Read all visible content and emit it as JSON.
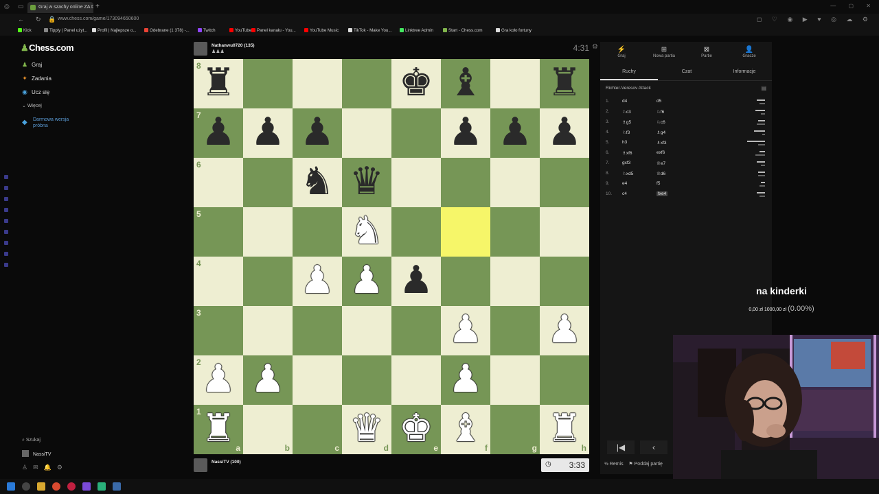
{
  "browser": {
    "tab_title": "Graj w szachy online ZA D...",
    "new_tab": "+",
    "url": "www.chess.com/game/173094650600"
  },
  "bookmarks": [
    {
      "label": "Kick",
      "color": "#53fc18"
    },
    {
      "label": "Tipply | Panel użyt...",
      "color": "#888888"
    },
    {
      "label": "Profil | Najlepsze o...",
      "color": "#dddddd"
    },
    {
      "label": "Odebrane (1 378) -...",
      "color": "#ea4335"
    },
    {
      "label": "Twitch",
      "color": "#9146ff"
    },
    {
      "label": "YouTube",
      "color": "#ff0000"
    },
    {
      "label": "Panel kanału - You...",
      "color": "#ff0000"
    },
    {
      "label": "YouTube Music",
      "color": "#ff0000"
    },
    {
      "label": "TikTok - Make You...",
      "color": "#dddddd"
    },
    {
      "label": "Linktree Admin",
      "color": "#43e660"
    },
    {
      "label": "Start - Chess.com",
      "color": "#81b64c"
    },
    {
      "label": "Gra koło fortuny",
      "color": "#dddddd"
    }
  ],
  "leftnav": {
    "logo": "Chess.com",
    "items": [
      {
        "label": "Graj",
        "icon": "board-icon",
        "glyph": "♟",
        "color": "#81b64c"
      },
      {
        "label": "Zadania",
        "icon": "puzzle-icon",
        "glyph": "✦",
        "color": "#e58f2a"
      },
      {
        "label": "Ucz się",
        "icon": "learn-icon",
        "glyph": "◉",
        "color": "#4aa3df"
      }
    ],
    "more": "Więcej",
    "trial": "Darmowa wersja próbna",
    "search": "Szukaj",
    "user": "NassiTV"
  },
  "players": {
    "top": {
      "name": "Nathanwu0720 (135)",
      "captured": "♟♟♟"
    },
    "bottom": {
      "name": "NassiTV (100)",
      "captured": ""
    }
  },
  "clocks": {
    "top": "4:31",
    "bottom": "3:33"
  },
  "board": {
    "ranks": [
      "8",
      "7",
      "6",
      "5",
      "4",
      "3",
      "2",
      "1"
    ],
    "files": [
      "a",
      "b",
      "c",
      "d",
      "e",
      "f",
      "g",
      "h"
    ],
    "highlight": [
      "f5"
    ],
    "pieces": {
      "a8": "bR",
      "e8": "bK",
      "f8": "bB",
      "h8": "bR",
      "a7": "bP",
      "b7": "bP",
      "c7": "bP",
      "f7": "bP",
      "g7": "bP",
      "h7": "bP",
      "c6": "bN",
      "d6": "bQ",
      "d5": "wN",
      "c4": "wP",
      "d4": "wP",
      "e4": "bP",
      "f3": "wP",
      "h3": "wP",
      "a2": "wP",
      "b2": "wP",
      "f2": "wP",
      "a1": "wR",
      "d1": "wQ",
      "e1": "wK",
      "f1": "wB",
      "h1": "wR"
    }
  },
  "panel": {
    "tabs": [
      {
        "label": "Graj",
        "glyph": "⚡"
      },
      {
        "label": "Nowa partia",
        "glyph": "⊞"
      },
      {
        "label": "Partie",
        "glyph": "⊠"
      },
      {
        "label": "Gracze",
        "glyph": "👤"
      }
    ],
    "subtabs": [
      "Ruchy",
      "Czat",
      "Informacje"
    ],
    "opening": "Richter-Veresov Attack",
    "moves": [
      {
        "n": "1.",
        "w": "d4",
        "b": "d5"
      },
      {
        "n": "2.",
        "w": "♘c3",
        "b": "♘f6"
      },
      {
        "n": "3.",
        "w": "♗g5",
        "b": "♘c6"
      },
      {
        "n": "4.",
        "w": "♘f3",
        "b": "♗g4"
      },
      {
        "n": "5.",
        "w": "h3",
        "b": "♗xf3"
      },
      {
        "n": "6.",
        "w": "♗xf6",
        "b": "exf6"
      },
      {
        "n": "7.",
        "w": "gxf3",
        "b": "♕e7"
      },
      {
        "n": "8.",
        "w": "♘xd5",
        "b": "♕d6"
      },
      {
        "n": "9.",
        "w": "e4",
        "b": "f5"
      },
      {
        "n": "10.",
        "w": "c4",
        "b": "fxe4"
      }
    ],
    "actions": [
      "½ Remis",
      "Poddaj partię"
    ]
  },
  "overlay": {
    "title": "na kinderki",
    "amount": "0,00 zł  1000,00 zł",
    "pct": "(0.00%)"
  }
}
